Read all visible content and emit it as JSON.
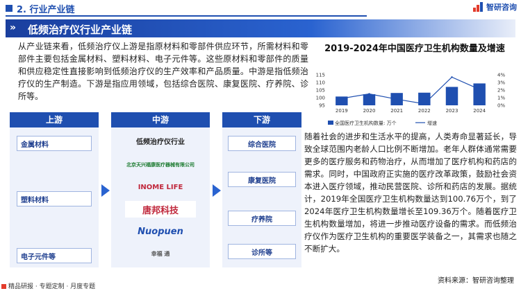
{
  "header": {
    "section": "2. 行业产业链",
    "logo_text": "智研咨询",
    "banner_title": "低频治疗仪行业产业链"
  },
  "intro": "从产业链来看，低频治疗仪上游是指原材料和零部件供应环节，所需材料和零部件主要包括金属材料、塑料材料、电子元件等。这些原材料和零部件的质量和供应稳定性直接影响到低频治疗仪的生产效率和产品质量。中游是指低频治疗仪的生产制造。下游是指应用领域，包括综合医院、康复医院、疗养院、诊所等。",
  "chain": {
    "upstream": {
      "label": "上游",
      "items": [
        "金属材料",
        "塑料材料",
        "电子元件等"
      ]
    },
    "midstream": {
      "label": "中游",
      "subtitle": "低频治疗仪行业",
      "brands": [
        "北京天兴福康医疗器械有限公司",
        "INOME LIFE",
        "唐邦科技",
        "Nuopuen",
        "幸福 通"
      ]
    },
    "downstream": {
      "label": "下游",
      "items": [
        "综合医院",
        "康复医院",
        "疗养院",
        "诊所等"
      ]
    }
  },
  "chart_data": {
    "type": "bar",
    "title": "2019-2024年中国医疗卫生机构数量及增速",
    "categories": [
      "2019",
      "2020",
      "2021",
      "2022",
      "2023",
      "2024"
    ],
    "series": [
      {
        "name": "全国医疗卫生机构数量: 万个",
        "type": "bar",
        "values": [
          100.76,
          102.29,
          103.09,
          103.29,
          107.08,
          109.36
        ]
      },
      {
        "name": "增速",
        "type": "line",
        "axis": "right",
        "values": [
          0.9,
          1.5,
          0.8,
          0.2,
          3.7,
          2.1
        ]
      }
    ],
    "ylim_left": [
      95,
      115
    ],
    "yticks_left": [
      "95",
      "100",
      "105",
      "110",
      "115"
    ],
    "ylim_right": [
      0,
      4
    ],
    "yticks_right": [
      "0%",
      "1%",
      "2%",
      "3%",
      "4%"
    ],
    "legend_position": "bottom",
    "colors": {
      "bar": "#1f4fb0",
      "line": "#1f4fb0"
    }
  },
  "body_text": "随着社会的进步和生活水平的提高，人类寿命显著延长，导致全球范围内老龄人口比例不断增加。老年人群体通常需要更多的医疗服务和药物治疗，从而增加了医疗机构和药店的需求。同时，中国政府正实施的医疗改革政策，鼓励社会资本进入医疗领域，推动民营医院、诊所和药店的发展。据统计，2019年全国医疗卫生机构数量达到100.76万个，到了2024年医疗卫生机构数量增长至109.36万个。随着医疗卫生机构数量增加，将进一步推动医疗设备的需求。而低频治疗仪作为医疗卫生机构的重要医学装备之一，其需求也随之不断扩大。",
  "source": "资料来源：智研咨询整理",
  "footer": "精品研报 · 专题定制 · 月度专题"
}
